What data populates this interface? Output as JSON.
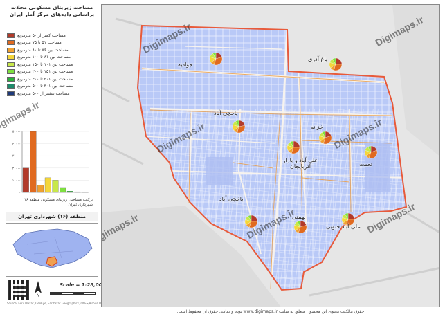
{
  "sidebar": {
    "title_line1": "مساحت زیربنای مسکونی محلات",
    "title_line2": "براساس داده‌های مرکز آمار ایران"
  },
  "legend": [
    {
      "label": "مساحت کمتر از ۵۰ مترمربع",
      "color": "#b23a2a"
    },
    {
      "label": "مساحت ۵۱ تا ۷۵ مترمربع",
      "color": "#e06a20"
    },
    {
      "label": "مساحت بین ۷۶ تا ۸۰ مترمربع",
      "color": "#f0a030"
    },
    {
      "label": "مساحت بین ۸۱ تا ۱۰۰ مترمربع",
      "color": "#f4d63a"
    },
    {
      "label": "مساحت بین ۱۰۱ تا ۱۵۰ مترمربع",
      "color": "#c8e84a"
    },
    {
      "label": "مساحت بین ۱۵۱ تا ۲۰۰ مترمربع",
      "color": "#7ee040"
    },
    {
      "label": "مساحت بین ۲۰۱ تا ۳۰۰ مترمربع",
      "color": "#2ab23a"
    },
    {
      "label": "مساحت بین ۳۰۱ تا ۵۰۰ مترمربع",
      "color": "#1e8a6a"
    },
    {
      "label": "مساحت بیشتر از ۵۰۰ مترمربع",
      "color": "#1e3a7a"
    }
  ],
  "chart_data": {
    "type": "bar",
    "categories": [
      "<50",
      "51-75",
      "76-80",
      "81-100",
      "101-150",
      "151-200",
      "201-300",
      "301-500",
      ">500"
    ],
    "values": [
      2.0,
      5.0,
      0.6,
      1.2,
      1.0,
      0.4,
      0.1,
      0.05,
      0.02
    ],
    "colors": [
      "#b23a2a",
      "#e06a20",
      "#f0a030",
      "#f4d63a",
      "#c8e84a",
      "#7ee040",
      "#2ab23a",
      "#1e8a6a",
      "#1e3a7a"
    ],
    "ylim": [
      0,
      5
    ],
    "yticks": [
      "۰",
      "۱۰۰۰۰",
      "۲۰۰۰۰",
      "۳۰۰۰۰",
      "۴۰۰۰۰",
      "۵۰۰۰۰"
    ],
    "caption": "ترکیب مساحتی زیربنای مسکونی منطقه ۱۶ شهرداری تهران"
  },
  "region_title": "منطقه (۱۶) شهرداری تهران",
  "scale": "Scale = 1:28,000",
  "credit": "Source: Esri, Maxar, GeoEye, Earthstar Geographics, CNES/Airbus DS, USDA, USGS, AeroGRID, IGN",
  "watermark": "Digimaps.ir",
  "footer": "حقوق مالکیت معنوی این محصول متعلق به سایت www.digimaps.ir بوده و تمامی حقوق آن محفوظ است.",
  "map": {
    "fill_color": "#b9c9f7",
    "boundary_color": "#e85a3a",
    "pie_colors": [
      "#b23a2a",
      "#e06a20",
      "#f0a030",
      "#f4d63a",
      "#c8e84a",
      "#7ee040"
    ]
  },
  "neighborhoods": [
    {
      "label": "جوادیه",
      "pie": [
        0.2,
        0.35,
        0.1,
        0.15,
        0.12,
        0.08
      ]
    },
    {
      "label": "باغ آذری",
      "pie": [
        0.25,
        0.3,
        0.1,
        0.15,
        0.12,
        0.08
      ]
    },
    {
      "label": "یاخچی آباد",
      "pie": [
        0.22,
        0.32,
        0.1,
        0.16,
        0.12,
        0.08
      ]
    },
    {
      "label": "خزانه",
      "pie": [
        0.2,
        0.35,
        0.1,
        0.15,
        0.12,
        0.08
      ]
    },
    {
      "label": "علی آباد و بازار آذربایجان",
      "pie": [
        0.25,
        0.3,
        0.1,
        0.15,
        0.12,
        0.08
      ]
    },
    {
      "label": "نعمت",
      "pie": [
        0.2,
        0.35,
        0.1,
        0.15,
        0.12,
        0.08
      ]
    },
    {
      "label": "یاخچی آباد",
      "pie": [
        0.25,
        0.3,
        0.1,
        0.15,
        0.12,
        0.08
      ]
    },
    {
      "label": "بهمنی",
      "pie": [
        0.2,
        0.35,
        0.1,
        0.15,
        0.12,
        0.08
      ]
    },
    {
      "label": "علی آباد جنوبی",
      "pie": [
        0.25,
        0.3,
        0.1,
        0.15,
        0.12,
        0.08
      ]
    }
  ]
}
